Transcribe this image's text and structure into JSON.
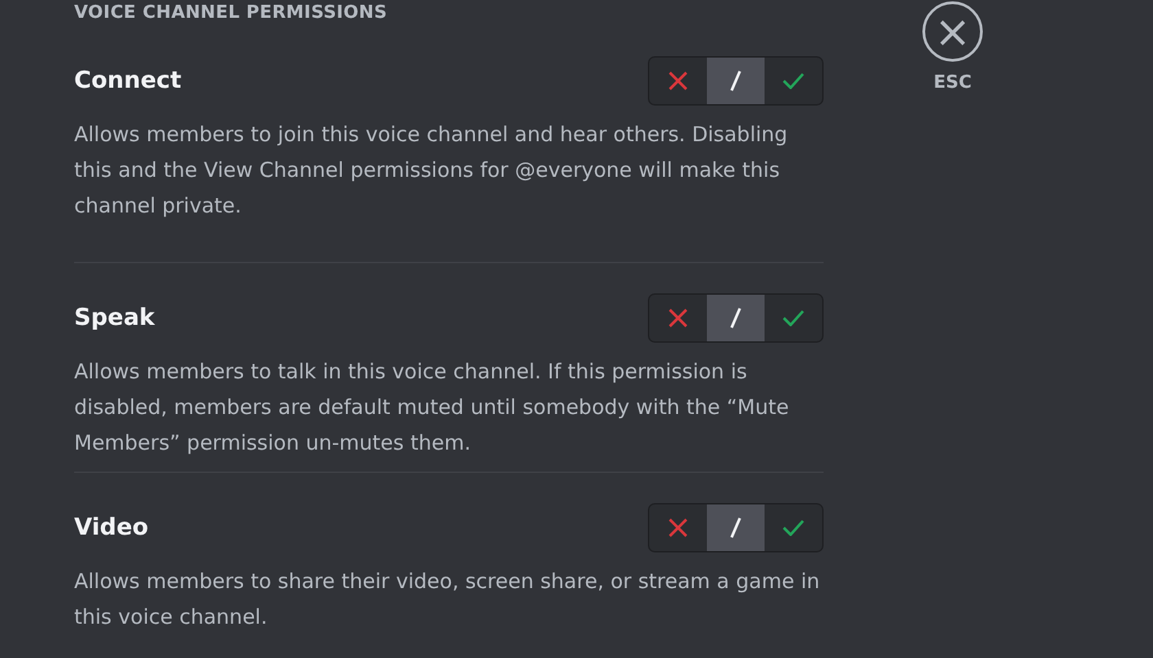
{
  "heading": "VOICE CHANNEL PERMISSIONS",
  "close": {
    "icon": "×",
    "label": "ESC"
  },
  "permissions": [
    {
      "name": "Connect",
      "description": "Allows members to join this voice channel and hear others. Disabling this and the View Channel permissions for @everyone will make this channel private.",
      "options": [
        {
          "kind": "deny",
          "selected": false
        },
        {
          "kind": "neutral",
          "selected": true
        },
        {
          "kind": "allow",
          "selected": false
        }
      ]
    },
    {
      "name": "Speak",
      "description": "Allows members to talk in this voice channel. If this permission is disabled, members are default muted until somebody with the “Mute Members” permission un-mutes them.",
      "options": [
        {
          "kind": "deny",
          "selected": false
        },
        {
          "kind": "neutral",
          "selected": true
        },
        {
          "kind": "allow",
          "selected": false
        }
      ]
    },
    {
      "name": "Video",
      "description": "Allows members to share their video, screen share, or stream a game in this voice channel.",
      "options": [
        {
          "kind": "deny",
          "selected": false
        },
        {
          "kind": "neutral",
          "selected": true
        },
        {
          "kind": "allow",
          "selected": false
        }
      ]
    }
  ]
}
